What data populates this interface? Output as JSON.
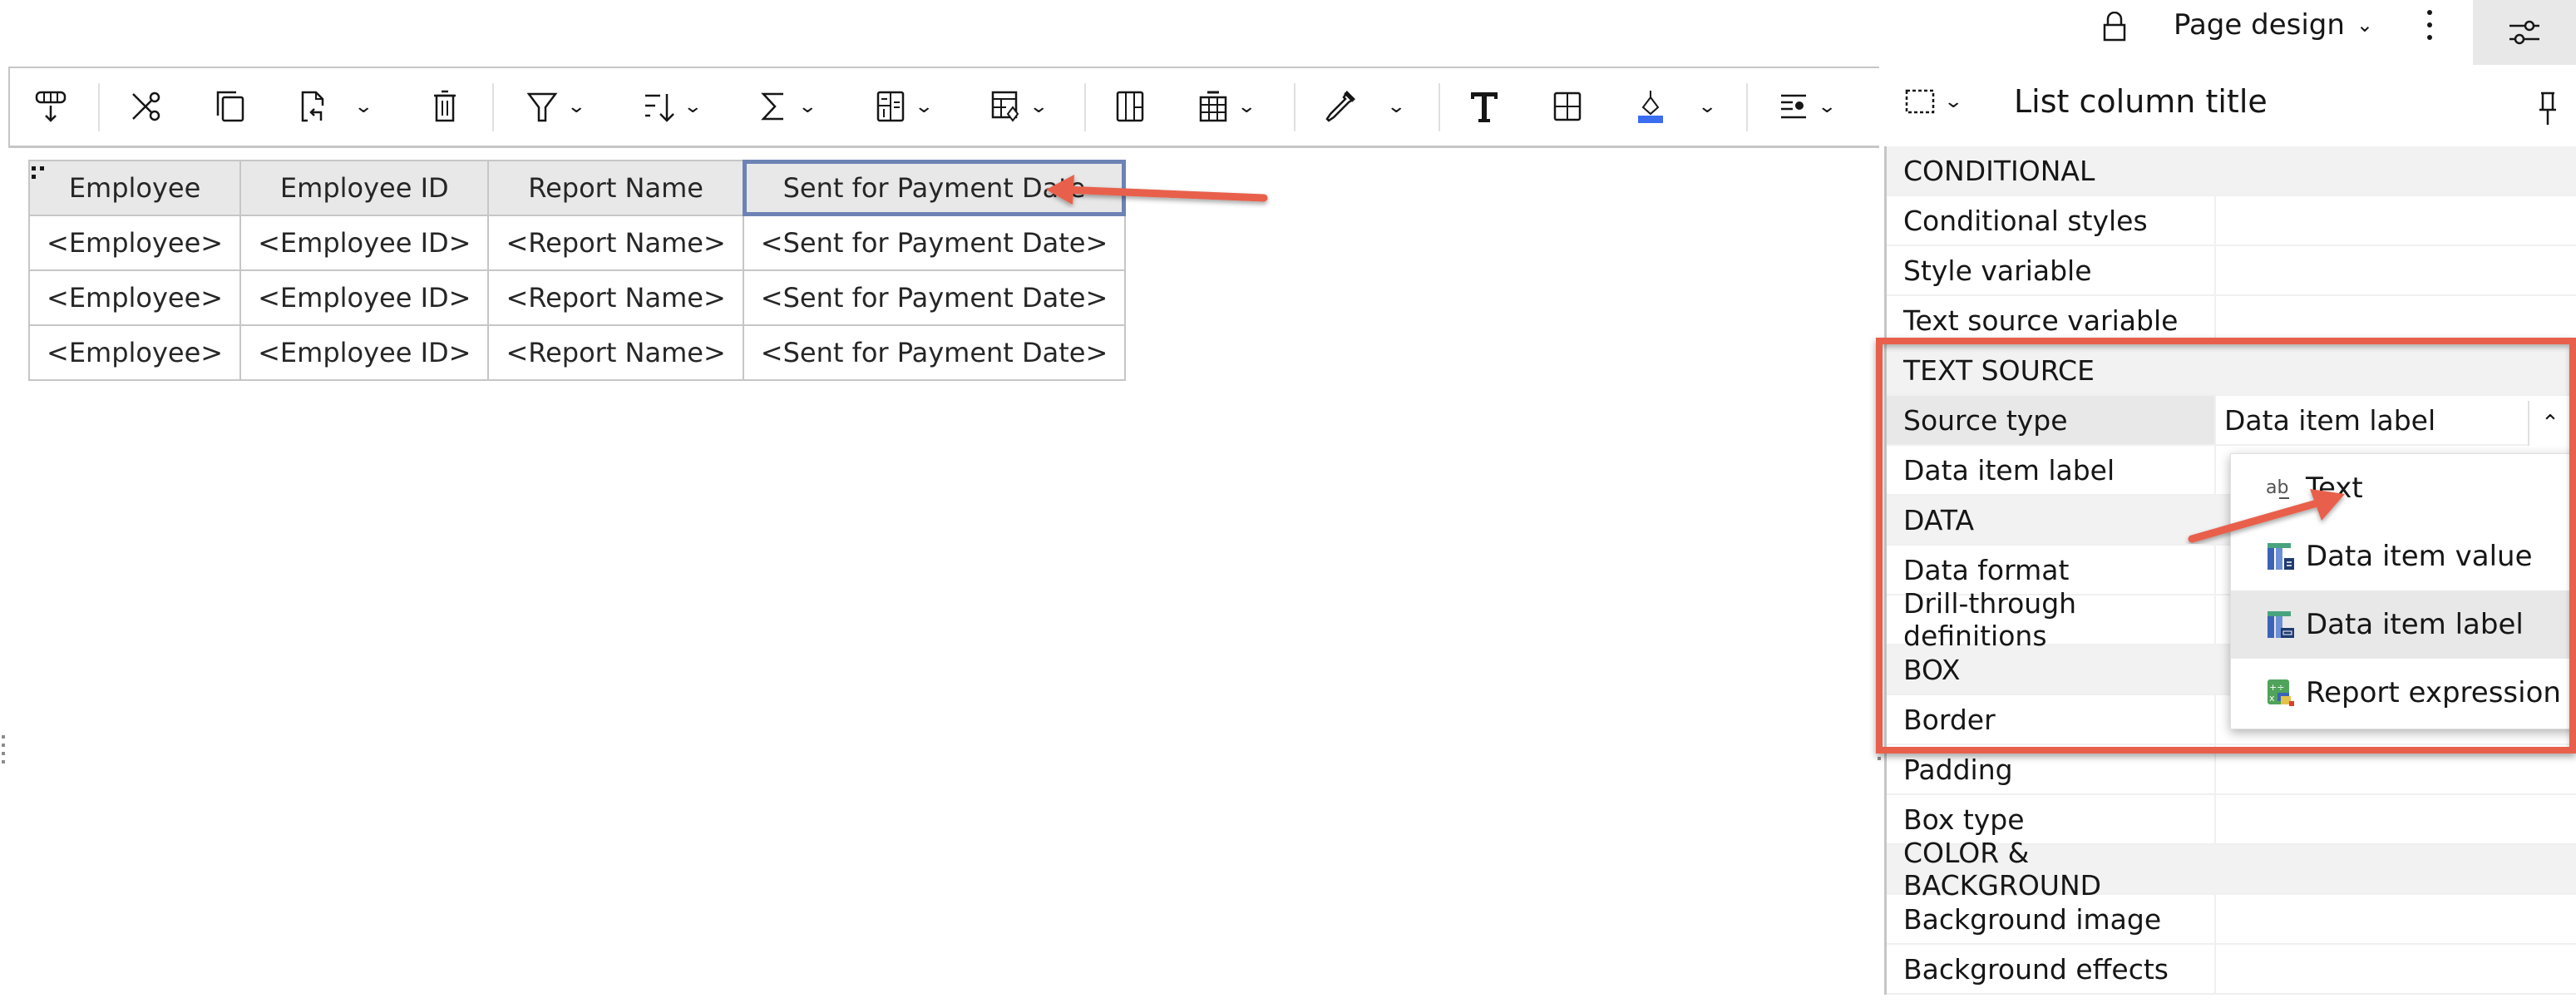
{
  "topbar": {
    "lock_icon": "lock-icon",
    "view_mode": "Page design",
    "more_icon": "overflow-menu-icon",
    "properties_icon": "sliders-icon"
  },
  "toolbar": {
    "items": [
      {
        "icon": "insert-rows-icon"
      },
      {
        "icon": "cut-icon"
      },
      {
        "icon": "copy-icon"
      },
      {
        "icon": "paste-icon",
        "dropdown": true
      },
      {
        "icon": "delete-icon"
      },
      {
        "icon": "filter-icon",
        "dropdown": true
      },
      {
        "icon": "sort-icon",
        "dropdown": true
      },
      {
        "icon": "summarize-icon",
        "dropdown": true
      },
      {
        "icon": "group-icon",
        "dropdown": true
      },
      {
        "icon": "calculations-icon",
        "dropdown": true
      },
      {
        "icon": "column-icon"
      },
      {
        "icon": "table-icon",
        "dropdown": true
      },
      {
        "icon": "pick-style-icon",
        "dropdown": true
      },
      {
        "icon": "text-font-icon"
      },
      {
        "icon": "borders-icon"
      },
      {
        "icon": "fill-color-icon",
        "dropdown": true,
        "color": "#3a6df0"
      },
      {
        "icon": "text-align-icon",
        "dropdown": true
      },
      {
        "icon": "select-ancestor-icon",
        "dropdown": true
      }
    ]
  },
  "report_table": {
    "headers": [
      "Employee",
      "Employee ID",
      "Report Name",
      "Sent for Payment Date"
    ],
    "selected_header": "Sent for Payment Date",
    "rows": [
      [
        "<Employee>",
        "<Employee ID>",
        "<Report Name>",
        "<Sent for Payment Date>"
      ],
      [
        "<Employee>",
        "<Employee ID>",
        "<Report Name>",
        "<Sent for Payment Date>"
      ],
      [
        "<Employee>",
        "<Employee ID>",
        "<Report Name>",
        "<Sent for Payment Date>"
      ]
    ]
  },
  "properties_panel": {
    "title": "List column title",
    "rows": [
      {
        "type": "section",
        "label": "CONDITIONAL"
      },
      {
        "type": "prop",
        "label": "Conditional styles",
        "value": ""
      },
      {
        "type": "prop",
        "label": "Style variable",
        "value": ""
      },
      {
        "type": "prop",
        "label": "Text source variable",
        "value": ""
      },
      {
        "type": "section",
        "label": "TEXT SOURCE"
      },
      {
        "type": "prop",
        "label": "Source type",
        "value": "Data item label",
        "highlighted": true
      },
      {
        "type": "prop",
        "label": "Data item label",
        "value": ""
      },
      {
        "type": "section",
        "label": "DATA"
      },
      {
        "type": "prop",
        "label": "Data format",
        "value": ""
      },
      {
        "type": "prop",
        "label": "Drill-through definitions",
        "value": ""
      },
      {
        "type": "section",
        "label": "BOX"
      },
      {
        "type": "prop",
        "label": "Border",
        "value": ""
      },
      {
        "type": "prop",
        "label": "Padding",
        "value": ""
      },
      {
        "type": "prop",
        "label": "Box type",
        "value": ""
      },
      {
        "type": "section",
        "label": "COLOR & BACKGROUND"
      },
      {
        "type": "prop",
        "label": "Background image",
        "value": ""
      },
      {
        "type": "prop",
        "label": "Background effects",
        "value": ""
      }
    ]
  },
  "source_type_menu": {
    "options": [
      {
        "label": "Text",
        "icon": "text-icon"
      },
      {
        "label": "Data item value",
        "icon": "data-item-value-icon"
      },
      {
        "label": "Data item label",
        "icon": "data-item-label-icon",
        "active": true
      },
      {
        "label": "Report expression",
        "icon": "report-expression-icon"
      }
    ]
  },
  "annotations": {
    "arrow_color": "#e8604c",
    "highlight_box_color": "#e8604c",
    "selection_color": "#6d83b5"
  }
}
